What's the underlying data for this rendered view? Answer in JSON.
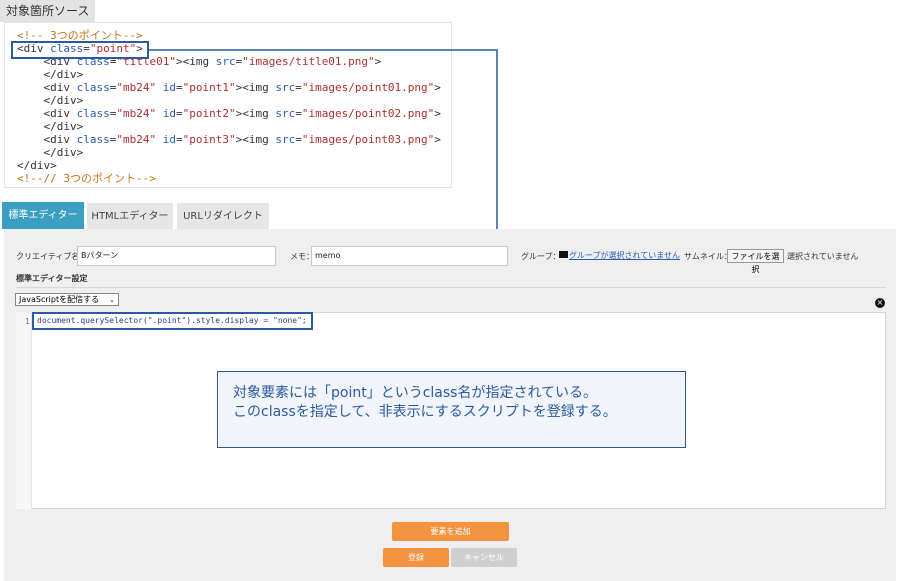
{
  "source": {
    "label": "対象箇所ソース",
    "lines": [
      [
        {
          "t": "<!-- 3つのポイント-->",
          "c": "cmt"
        }
      ],
      [
        {
          "t": "<div ",
          "c": "tag"
        },
        {
          "t": "class",
          "c": "attr"
        },
        {
          "t": "=",
          "c": "tag"
        },
        {
          "t": "\"point\"",
          "c": "str"
        },
        {
          "t": ">",
          "c": "tag"
        }
      ],
      [
        {
          "t": "    <div ",
          "c": "tag"
        },
        {
          "t": "class",
          "c": "attr"
        },
        {
          "t": "=",
          "c": "tag"
        },
        {
          "t": "\"title01\"",
          "c": "str"
        },
        {
          "t": "><img ",
          "c": "tag"
        },
        {
          "t": "src",
          "c": "attr"
        },
        {
          "t": "=",
          "c": "tag"
        },
        {
          "t": "\"images/title01.png\"",
          "c": "str"
        },
        {
          "t": ">",
          "c": "tag"
        }
      ],
      [
        {
          "t": "    </div>",
          "c": "tag"
        }
      ],
      [
        {
          "t": "    <div ",
          "c": "tag"
        },
        {
          "t": "class",
          "c": "attr"
        },
        {
          "t": "=",
          "c": "tag"
        },
        {
          "t": "\"mb24\"",
          "c": "str"
        },
        {
          "t": " ",
          "c": "tag"
        },
        {
          "t": "id",
          "c": "attr"
        },
        {
          "t": "=",
          "c": "tag"
        },
        {
          "t": "\"point1\"",
          "c": "str"
        },
        {
          "t": "><img ",
          "c": "tag"
        },
        {
          "t": "src",
          "c": "attr"
        },
        {
          "t": "=",
          "c": "tag"
        },
        {
          "t": "\"images/point01.png\"",
          "c": "str"
        },
        {
          "t": ">",
          "c": "tag"
        }
      ],
      [
        {
          "t": "    </div>",
          "c": "tag"
        }
      ],
      [
        {
          "t": "    <div ",
          "c": "tag"
        },
        {
          "t": "class",
          "c": "attr"
        },
        {
          "t": "=",
          "c": "tag"
        },
        {
          "t": "\"mb24\"",
          "c": "str"
        },
        {
          "t": " ",
          "c": "tag"
        },
        {
          "t": "id",
          "c": "attr"
        },
        {
          "t": "=",
          "c": "tag"
        },
        {
          "t": "\"point2\"",
          "c": "str"
        },
        {
          "t": "><img ",
          "c": "tag"
        },
        {
          "t": "src",
          "c": "attr"
        },
        {
          "t": "=",
          "c": "tag"
        },
        {
          "t": "\"images/point02.png\"",
          "c": "str"
        },
        {
          "t": ">",
          "c": "tag"
        }
      ],
      [
        {
          "t": "    </div>",
          "c": "tag"
        }
      ],
      [
        {
          "t": "    <div ",
          "c": "tag"
        },
        {
          "t": "class",
          "c": "attr"
        },
        {
          "t": "=",
          "c": "tag"
        },
        {
          "t": "\"mb24\"",
          "c": "str"
        },
        {
          "t": " ",
          "c": "tag"
        },
        {
          "t": "id",
          "c": "attr"
        },
        {
          "t": "=",
          "c": "tag"
        },
        {
          "t": "\"point3\"",
          "c": "str"
        },
        {
          "t": "><img ",
          "c": "tag"
        },
        {
          "t": "src",
          "c": "attr"
        },
        {
          "t": "=",
          "c": "tag"
        },
        {
          "t": "\"images/point03.png\"",
          "c": "str"
        },
        {
          "t": ">",
          "c": "tag"
        }
      ],
      [
        {
          "t": "    </div>",
          "c": "tag"
        }
      ],
      [
        {
          "t": "</div>",
          "c": "tag"
        }
      ],
      [
        {
          "t": "<!--// 3つのポイント-->",
          "c": "cmt"
        }
      ]
    ]
  },
  "tabs": [
    {
      "label": "標準エディター"
    },
    {
      "label": "HTMLエディター"
    },
    {
      "label": "URLリダイレクト"
    }
  ],
  "form": {
    "creative_label": "クリエイティブ名：",
    "creative_value": "Bパターン",
    "memo_label": "メモ：",
    "memo_value": "memo",
    "group_label": "グループ：",
    "group_link": "グループが選択されていません",
    "thumb_label": "サムネイル：",
    "file_button": "ファイルを選択",
    "file_status": "選択されていません",
    "section_title": "標準エディター設定",
    "js_select": "JavaScriptを配信する",
    "close_symbol": "×"
  },
  "editor": {
    "line_number": "1",
    "code": "document.querySelector(\".point\").style.display = \"none\";"
  },
  "buttons": {
    "add_element": "要素を追加",
    "register": "登録",
    "cancel": "キャンセル"
  },
  "callout": {
    "line1": "対象要素には「point」というclass名が指定されている。",
    "line2": "このclassを指定して、非表示にするスクリプトを登録する。"
  },
  "colors": {
    "accent_blue": "#2b5a9e",
    "tab_active": "#3a9fc0",
    "orange": "#f4933f"
  }
}
